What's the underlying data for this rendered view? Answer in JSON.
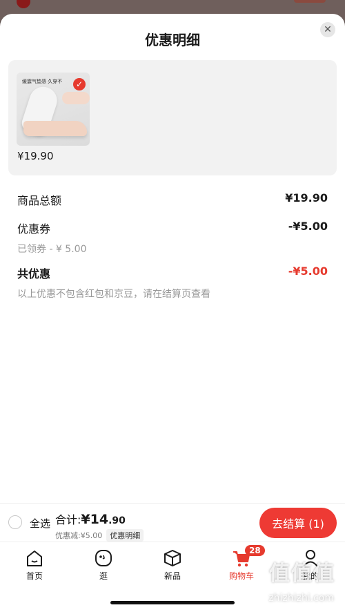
{
  "sheet": {
    "title": "优惠明细",
    "close_icon": "close-icon"
  },
  "product": {
    "image_caption": "缓震气垫感 久穿不",
    "price": "¥19.90",
    "selected": true
  },
  "summary": {
    "goods_total_label": "商品总额",
    "goods_total_value": "¥19.90",
    "coupon_label": "优惠券",
    "coupon_value": "-¥5.00",
    "coupon_detail": "已领券 - ¥ 5.00",
    "total_discount_label": "共优惠",
    "total_discount_value": "-¥5.00",
    "note": "以上优惠不包含红包和京豆，请在结算页查看"
  },
  "checkout": {
    "select_all_label": "全选",
    "total_prefix": "合计:",
    "total_currency": "¥",
    "total_integer": "14",
    "total_decimal": ".90",
    "discount_text": "优惠减:¥5.00",
    "discount_detail_link": "优惠明细",
    "checkout_button": "去结算 (1)"
  },
  "tabbar": {
    "items": [
      {
        "label": "首页",
        "icon": "home-icon"
      },
      {
        "label": "逛",
        "icon": "face-icon"
      },
      {
        "label": "新品",
        "icon": "box-icon"
      },
      {
        "label": "购物车",
        "icon": "cart-icon",
        "badge": "28",
        "active": true
      },
      {
        "label": "我的",
        "icon": "person-icon"
      }
    ]
  },
  "watermark": {
    "text": "值值值",
    "url": "zhizhizhi.com"
  },
  "colors": {
    "accent": "#e63a2e",
    "button": "#ee3a34",
    "muted": "#999999"
  }
}
